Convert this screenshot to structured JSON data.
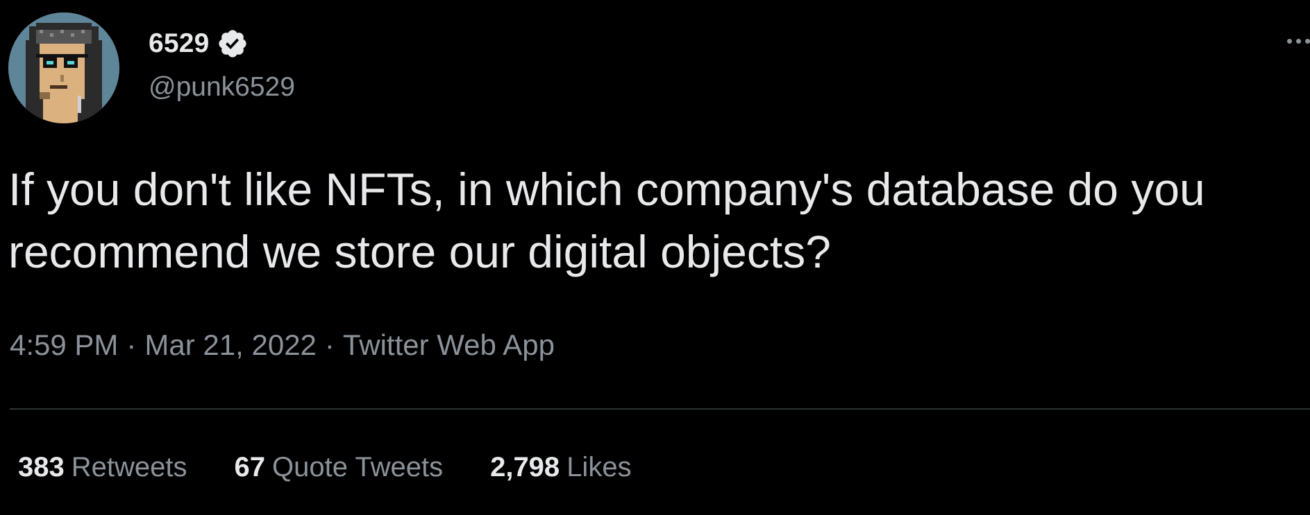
{
  "author": {
    "display_name": "6529",
    "handle": "@punk6529",
    "verified": true,
    "avatar_icon": "pixel-punk-avatar-icon"
  },
  "tweet": {
    "text": "If you don't like NFTs, in which company's database do you recommend we store our digital objects?",
    "time": "4:59 PM",
    "separator": "·",
    "date": "Mar 21, 2022",
    "source": "Twitter Web App"
  },
  "stats": {
    "retweets": {
      "count": "383",
      "label": "Retweets"
    },
    "quote_tweets": {
      "count": "67",
      "label": "Quote Tweets"
    },
    "likes": {
      "count": "2,798",
      "label": "Likes"
    }
  },
  "icons": {
    "verified": "verified-badge-icon",
    "more": "more-options-icon"
  },
  "colors": {
    "background": "#000000",
    "primary_text": "#e7e9ea",
    "secondary_text": "#8b9299",
    "divider": "#2f3336",
    "avatar_bg": "#5f8598"
  }
}
